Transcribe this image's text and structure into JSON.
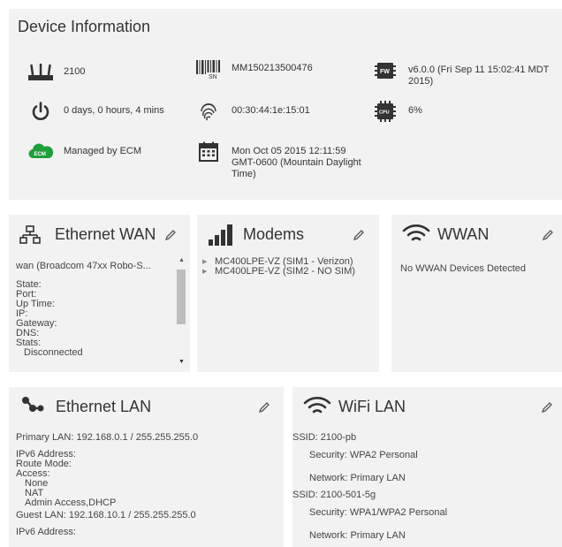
{
  "device_info": {
    "title": "Device Information",
    "model": "2100",
    "serial": "MM150213500476",
    "firmware": "v6.0.0 (Fri Sep 11 15:02:41 MDT 2015)",
    "uptime": "0 days, 0 hours, 4 mins",
    "mac": "00:30:44:1e:15:01",
    "cpu": "6%",
    "managed": "Managed by ECM",
    "date_line1": "Mon Oct 05 2015 12:11:59",
    "date_line2": "GMT-0600 (Mountain Daylight",
    "date_line3": "Time)",
    "icon_badges": {
      "sn": "SN",
      "fw": "FW",
      "cpu": "CPU",
      "ecm": "ECM"
    }
  },
  "ethernet_wan": {
    "title": "Ethernet WAN",
    "interface": "wan (Broadcom 47xx Robo-S...",
    "fields": [
      "State:",
      "Port:",
      "Up Time:",
      "IP:",
      "Gateway:",
      "DNS:",
      "Stats:"
    ],
    "status": "Disconnected"
  },
  "modems": {
    "title": "Modems",
    "items": [
      "MC400LPE-VZ (SIM1 - Verizon)",
      "MC400LPE-VZ (SIM2 - NO SIM)"
    ]
  },
  "wwan": {
    "title": "WWAN",
    "message": "No WWAN Devices Detected"
  },
  "ethernet_lan": {
    "title": "Ethernet LAN",
    "primary": "Primary LAN: 192.168.0.1 / 255.255.255.0",
    "lines": [
      "IPv6 Address:",
      "Route Mode:",
      "Access:"
    ],
    "access_items": [
      "None",
      "NAT",
      "Admin Access,DHCP"
    ],
    "guest": "Guest LAN: 192.168.10.1 / 255.255.255.0",
    "cut_line": "IPv6 Address:"
  },
  "wifi_lan": {
    "title": "WiFi LAN",
    "ssid1": "SSID: 2100-pb",
    "security1": "Security: WPA2 Personal",
    "network1": "Network: Primary LAN",
    "ssid2": "SSID: 2100-501-5g",
    "security2": "Security: WPA1/WPA2 Personal",
    "network2": "Network: Primary LAN"
  },
  "colors": {
    "panel": "#f2f2f2",
    "ecm_green": "#1f9e3a",
    "icon_dark": "#333333"
  }
}
